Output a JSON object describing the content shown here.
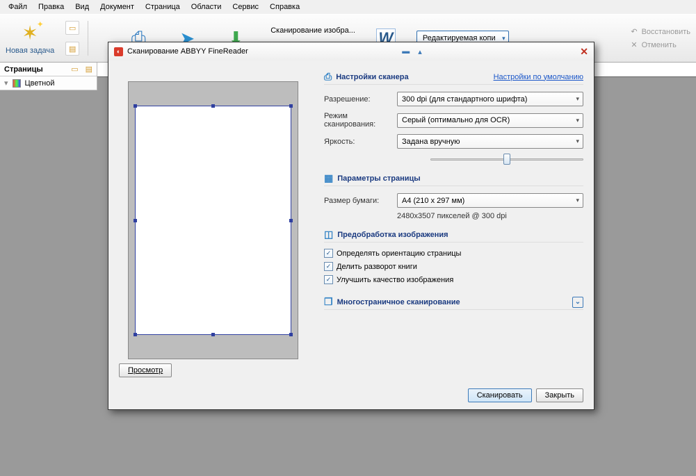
{
  "menu": [
    "Файл",
    "Правка",
    "Вид",
    "Документ",
    "Страница",
    "Области",
    "Сервис",
    "Справка"
  ],
  "toolbar": {
    "new_task": "Новая задача",
    "scan_label": "Сканирование изобра...",
    "copy_combo": "Редактируемая копи",
    "restore": "Восстановить",
    "cancel": "Отменить"
  },
  "sidebar": {
    "title": "Страницы",
    "view_mode": "Цветной"
  },
  "dialog": {
    "title": "Сканирование ABBYY FineReader",
    "sections": {
      "scanner": {
        "head": "Настройки сканера",
        "defaults_link": "Настройки по умолчанию",
        "resolution_lbl": "Разрешение:",
        "resolution_val": "300  dpi (для стандартного шрифта)",
        "mode_lbl": "Режим сканирования:",
        "mode_val": "Серый (оптимально для OCR)",
        "bright_lbl": "Яркость:",
        "bright_val": "Задана вручную"
      },
      "page": {
        "head": "Параметры страницы",
        "paper_lbl": "Размер бумаги:",
        "paper_val": "A4 (210 x 297 мм)",
        "px_info": "2480x3507 пикселей @ 300 dpi"
      },
      "pre": {
        "head": "Предобработка изображения",
        "opt1": "Определять ориентацию страницы",
        "opt2": "Делить разворот книги",
        "opt3": "Улучшить качество изображения"
      },
      "multi": {
        "head": "Многостраничное сканирование"
      }
    },
    "buttons": {
      "preview": "Просмотр",
      "scan": "Сканировать",
      "close": "Закрыть"
    }
  }
}
